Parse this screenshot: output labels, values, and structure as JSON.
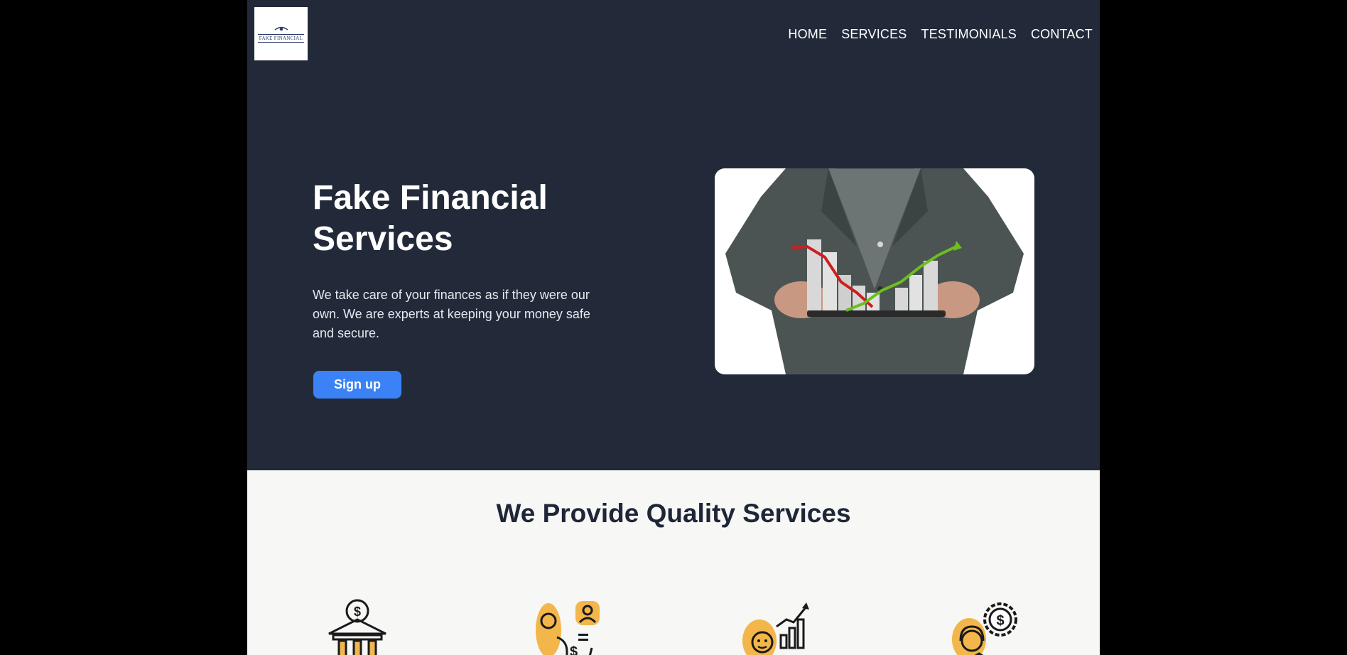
{
  "header": {
    "logo_text": "FAKE FINANCIAL",
    "nav": [
      "HOME",
      "SERVICES",
      "TESTIMONIALS",
      "CONTACT"
    ]
  },
  "hero": {
    "title": "Fake Financial Services",
    "description": "We take care of your finances as if they were our own. We are experts at keeping your money safe and secure.",
    "cta_label": "Sign up"
  },
  "services": {
    "title": "We Provide Quality Services",
    "icons": [
      "bank-dollar-icon",
      "support-agent-icon",
      "analyst-chart-icon",
      "agent-settings-dollar-icon"
    ]
  },
  "colors": {
    "header_bg": "#222a3a",
    "accent": "#3b82f6",
    "icon_accent": "#f3b64a",
    "services_bg": "#f7f7f5"
  }
}
